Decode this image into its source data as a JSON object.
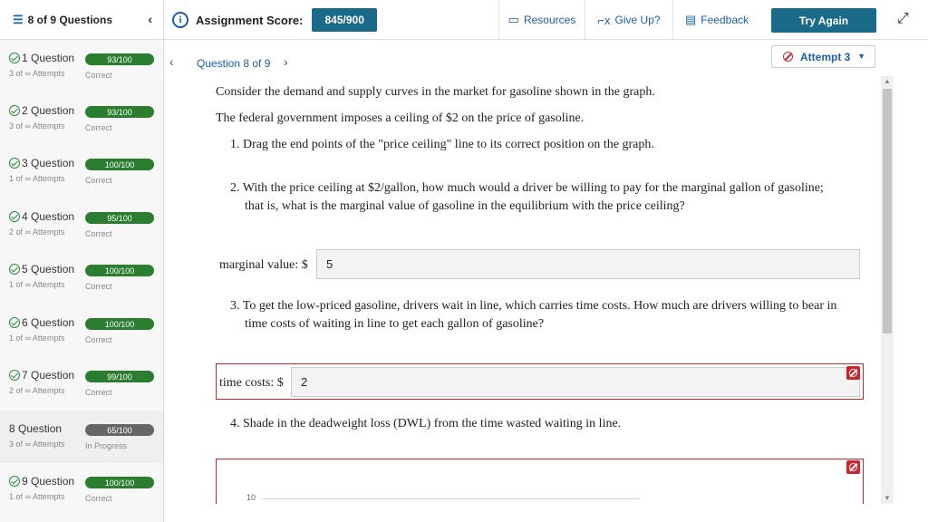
{
  "topbar": {
    "question_count": "8 of 9 Questions",
    "score_label": "Assignment Score:",
    "score_value": "845/900",
    "resources": "Resources",
    "give_up": "Give Up?",
    "feedback": "Feedback",
    "try_again": "Try Again"
  },
  "sidebar": {
    "items": [
      {
        "title": "1 Question",
        "score": "93/100",
        "attempts": "3 of ∞ Attempts",
        "status": "Correct"
      },
      {
        "title": "2 Question",
        "score": "93/100",
        "attempts": "3 of ∞ Attempts",
        "status": "Correct"
      },
      {
        "title": "3 Question",
        "score": "100/100",
        "attempts": "1 of ∞ Attempts",
        "status": "Correct"
      },
      {
        "title": "4 Question",
        "score": "95/100",
        "attempts": "2 of ∞ Attempts",
        "status": "Correct"
      },
      {
        "title": "5 Question",
        "score": "100/100",
        "attempts": "1 of ∞ Attempts",
        "status": "Correct"
      },
      {
        "title": "6 Question",
        "score": "100/100",
        "attempts": "1 of ∞ Attempts",
        "status": "Correct"
      },
      {
        "title": "7 Question",
        "score": "99/100",
        "attempts": "2 of ∞ Attempts",
        "status": "Correct"
      },
      {
        "title": "8 Question",
        "score": "65/100",
        "attempts": "3 of ∞ Attempts",
        "status": "In Progress"
      },
      {
        "title": "9 Question",
        "score": "100/100",
        "attempts": "1 of ∞ Attempts",
        "status": "Correct"
      }
    ]
  },
  "main": {
    "nav_title": "Question 8 of 9",
    "attempt_label": "Attempt 3",
    "intro": "Consider the demand and supply curves in the market for gasoline shown in the graph.",
    "ceiling": "The federal government imposes a ceiling of $2 on the price of gasoline.",
    "q1": "1. Drag the end points of the \"price ceiling\" line to its correct position on the graph.",
    "q2_line1": "2. With the price ceiling at $2/gallon, how much would a driver be willing to pay for the marginal gallon of gasoline;",
    "q2_line2": "that is, what is the marginal value of gasoline in the equilibrium with the price ceiling?",
    "marginal_label": "marginal value: $",
    "marginal_value": "5",
    "q3_line1": "3. To get the low-priced gasoline, drivers wait in line, which carries time costs. How much are drivers willing to bear in",
    "q3_line2": "time costs of waiting in line to get each gallon of gasoline?",
    "time_label": "time costs: $",
    "time_value": "2",
    "q4": "4. Shade in the deadweight loss (DWL) from the time wasted waiting in line.",
    "graph_tick": "10"
  },
  "colors": {
    "accent": "#1a5fa8",
    "button": "#1a6a8a",
    "correct": "#2b7d2f",
    "error": "#c9252c"
  }
}
